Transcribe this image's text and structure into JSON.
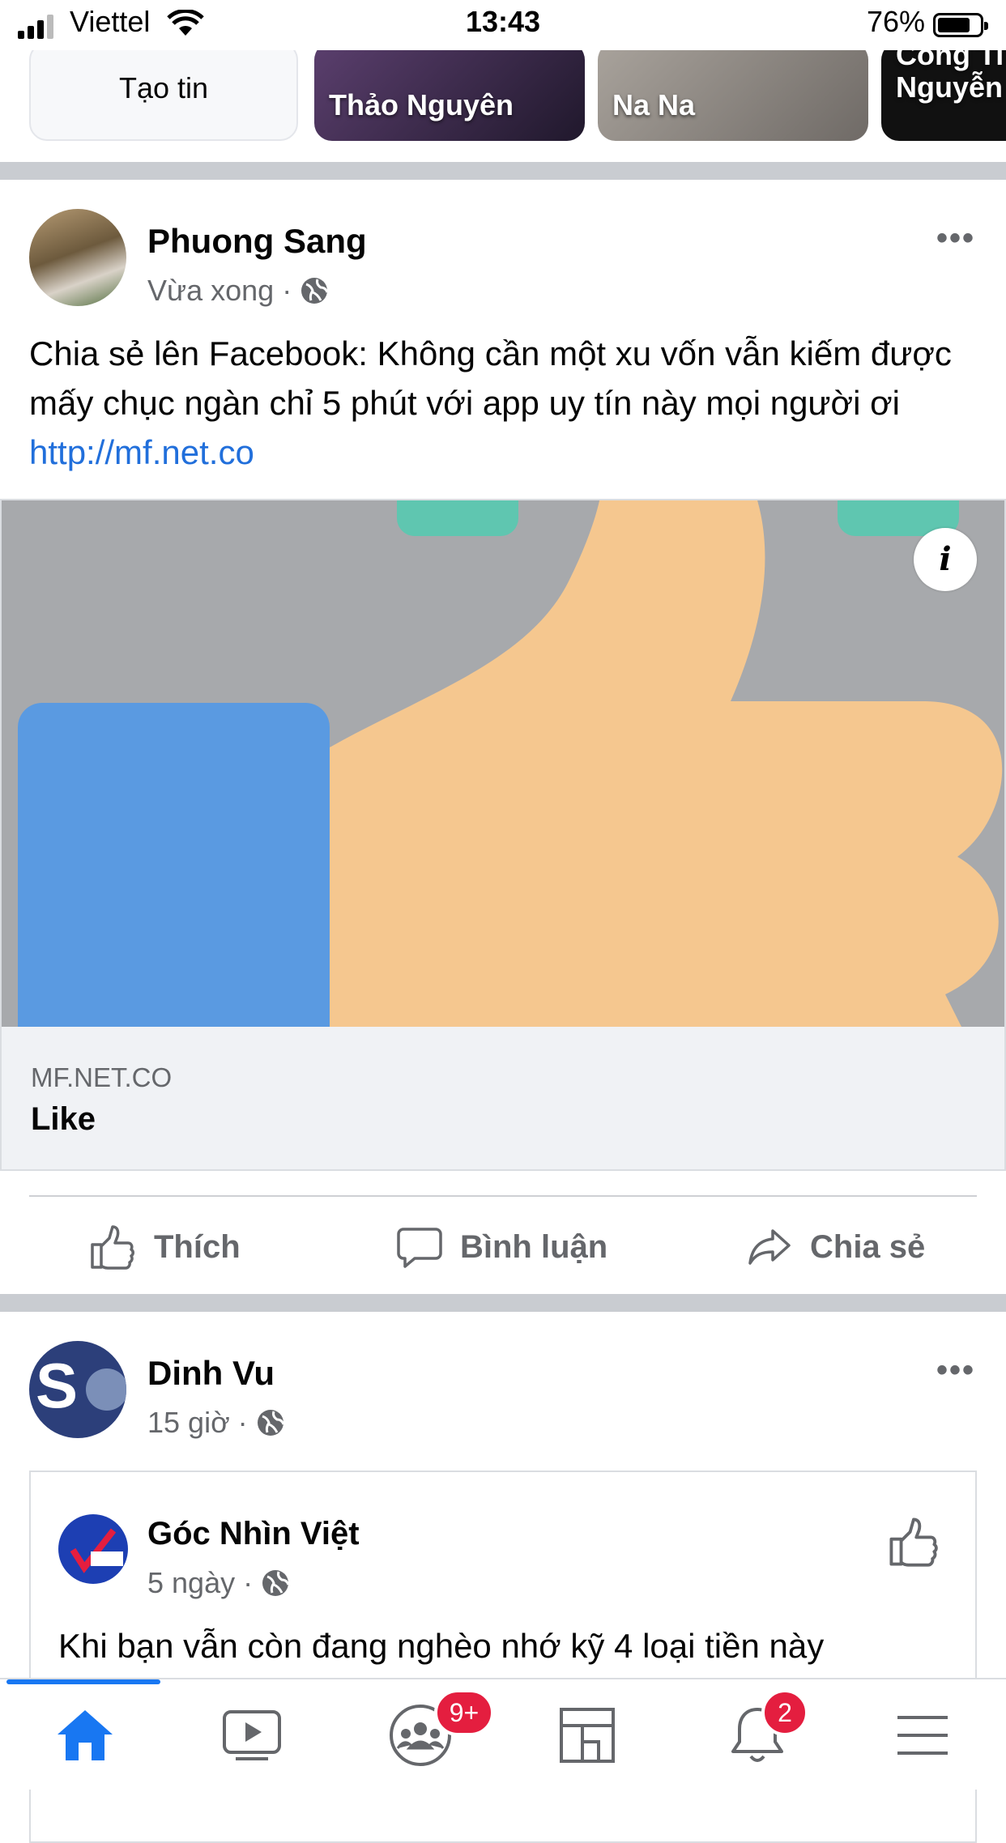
{
  "status_bar": {
    "carrier": "Viettel",
    "time": "13:43",
    "battery": "76%"
  },
  "stories": {
    "create_label": "Tạo tin",
    "items": [
      {
        "name": "Thảo Nguyên",
        "color": "#3a2f4a"
      },
      {
        "name": "Na Na",
        "color": "#8a8580"
      },
      {
        "name": "Cong Ti Nguyễn",
        "color": "#1a1a1a"
      }
    ]
  },
  "post1": {
    "author": "Phuong Sang",
    "time": "Vừa xong",
    "separator": "·",
    "more": "•••",
    "text": "Chia sẻ lên Facebook: Không cần một xu vốn vẫn kiếm được mấy chục ngàn chỉ 5 phút với app uy tín này mọi người ơi ",
    "link": "http://mf.net.co",
    "card": {
      "domain": "MF.NET.CO",
      "title": "Like",
      "info": "i"
    },
    "actions": {
      "like": "Thích",
      "comment": "Bình luận",
      "share": "Chia sẻ"
    }
  },
  "post2": {
    "author": "Dinh Vu",
    "time": "15 giờ",
    "separator": "·",
    "more": "•••",
    "shared": {
      "page": "Góc Nhìn Việt",
      "time": "5 ngày",
      "separator": "·",
      "text": "Khi bạn vẫn còn đang nghèo nhớ kỹ 4 loại tiền này"
    }
  },
  "bottom_nav": {
    "groups_badge": "9+",
    "notifications_badge": "2"
  },
  "colors": {
    "accent": "#1877f2",
    "link": "#216fdb",
    "badge": "#e41e3f"
  }
}
